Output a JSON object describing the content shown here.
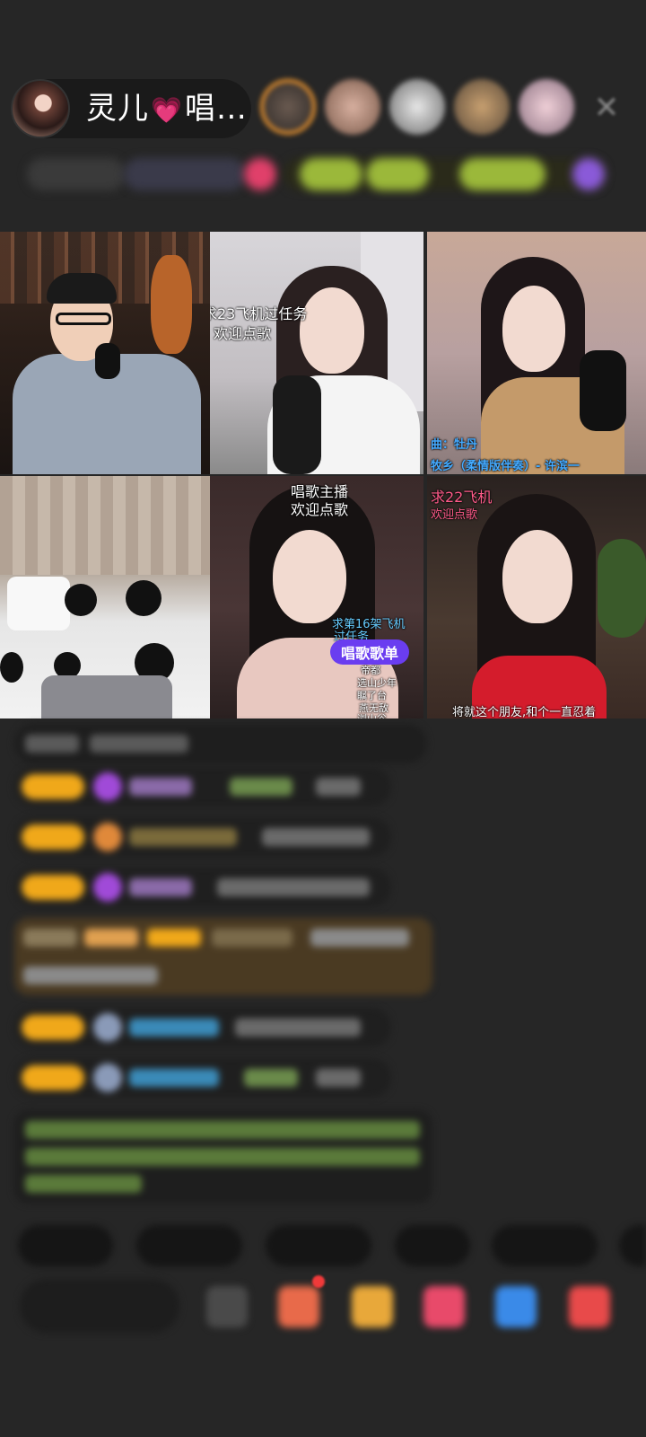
{
  "header": {
    "host_name": "灵儿",
    "host_name_suffix": "唱…",
    "heart_icon": "heart-icon",
    "close_icon": "close-icon"
  },
  "grid": {
    "tiles": [
      {
        "id": 1,
        "captions": []
      },
      {
        "id": 2,
        "captions": [
          "求23飞机过任务",
          "欢迎点歌"
        ]
      },
      {
        "id": 3,
        "captions": [
          "曲：牡丹",
          "牧乡（柔情版伴奏）- 许滨一"
        ]
      },
      {
        "id": 4,
        "captions": []
      },
      {
        "id": 5,
        "captions": [
          "唱歌主播",
          "欢迎点歌",
          "求第16架飞机",
          "过任务",
          "唱歌歌单",
          "帝都",
          "选山少年",
          "瞩了台",
          "燕无敌",
          "浏山谷"
        ]
      },
      {
        "id": 6,
        "captions": [
          "求22飞机",
          "欢迎点歌",
          "将就这个朋友,和个一直忍着"
        ]
      }
    ]
  },
  "colors": {
    "background": "#262626",
    "level_badge": "#f0a81a",
    "accent_purple": "#6a3df0",
    "accent_pink": "#ff4fa3",
    "chat_green": "#8bd36a",
    "chat_blue": "#4ab3e6"
  }
}
